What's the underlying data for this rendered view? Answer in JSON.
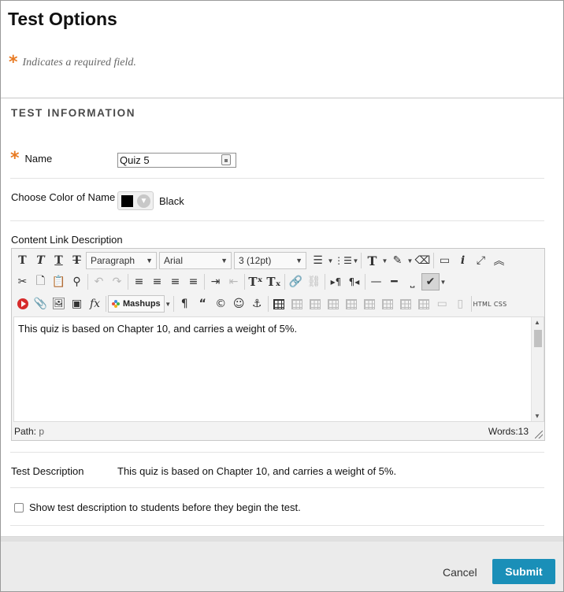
{
  "page": {
    "title": "Test Options",
    "required_note": "Indicates a required field."
  },
  "section": {
    "title": "TEST INFORMATION"
  },
  "fields": {
    "name_label": "Name",
    "name_value": "Quiz 5",
    "color_label": "Choose Color of Name",
    "color_value": "Black",
    "color_swatch": "#000000",
    "content_link_label": "Content Link Description"
  },
  "editor": {
    "format_select": "Paragraph",
    "font_select": "Arial",
    "size_select": "3 (12pt)",
    "mashups_label": "Mashups",
    "html_label": "HTML",
    "css_label": "CSS",
    "content": "This quiz is based on Chapter 10, and carries a weight of 5%.",
    "path_label": "Path:",
    "path_value": "p",
    "words_label": "Words:13"
  },
  "description": {
    "label": "Test Description",
    "value": "This quiz is based on Chapter 10, and carries a weight of 5%."
  },
  "options": {
    "show_description_label": "Show test description to students before they begin the test.",
    "show_description_checked": false
  },
  "footer": {
    "cancel_label": "Cancel",
    "submit_label": "Submit"
  },
  "colors": {
    "accent": "#1a8fb8",
    "required": "#e87a22"
  }
}
